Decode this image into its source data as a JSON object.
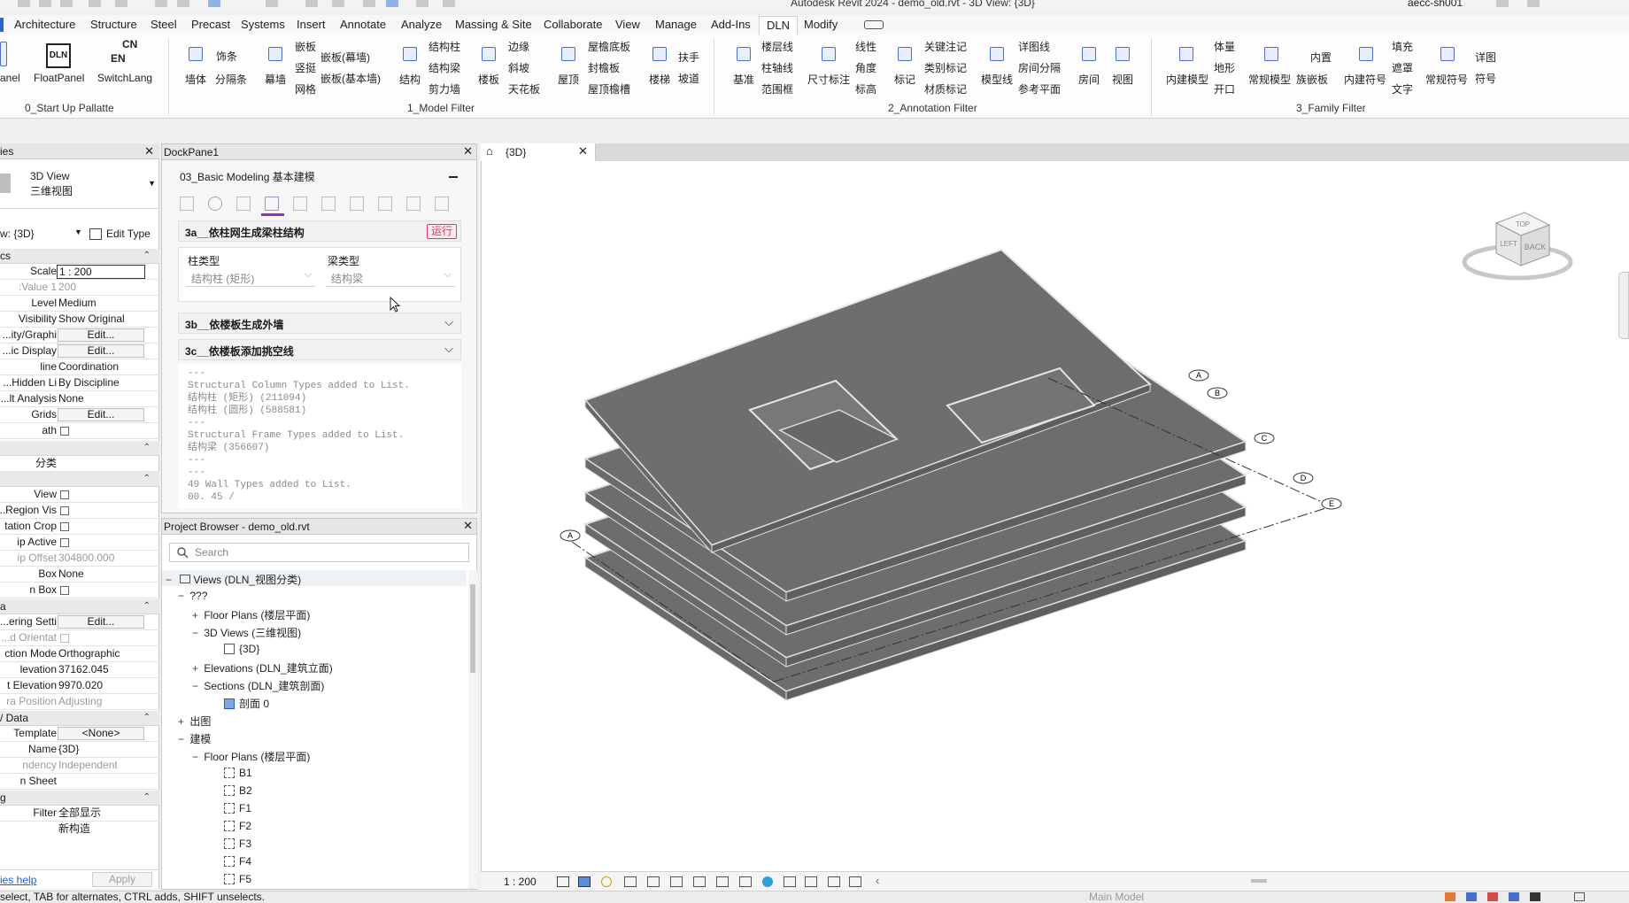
{
  "title_bar": {
    "title": "Autodesk Revit 2024 - demo_old.rvt - 3D View: {3D}",
    "user": "aecc-sh001"
  },
  "ribbon_tabs": [
    "Architecture",
    "Structure",
    "Steel",
    "Precast",
    "Systems",
    "Insert",
    "Annotate",
    "Analyze",
    "Massing & Site",
    "Collaborate",
    "View",
    "Manage",
    "Add-Ins",
    "DLN",
    "Modify"
  ],
  "active_tab": "DLN",
  "ribbon": {
    "startup": {
      "panel_label": "anel",
      "float_panel": "FloatPanel",
      "switch_lang": "SwitchLang",
      "switch_cn": "CN",
      "switch_en": "EN",
      "group": "0_Start Up Pallatte"
    },
    "model_filter": {
      "items": [
        "墙体",
        "饰条",
        "分隔条",
        "幕墙",
        "嵌板",
        "竖挺",
        "网格",
        "嵌板(幕墙)",
        "嵌板(基本墙)",
        "结构",
        "结构柱",
        "结构梁",
        "剪力墙",
        "楼板",
        "边缘",
        "斜坡",
        "天花板",
        "屋顶",
        "屋檐底板",
        "封檐板",
        "屋顶檐槽",
        "楼梯",
        "扶手",
        "坡道"
      ],
      "group": "1_Model Filter"
    },
    "annotation_filter": {
      "items": [
        "基准",
        "楼层线",
        "柱轴线",
        "范围框",
        "尺寸标注",
        "线性",
        "角度",
        "标高",
        "标记",
        "关键注记",
        "类别标记",
        "材质标记",
        "模型线",
        "详图线",
        "房间分隔",
        "参考平面",
        "房间",
        "视图"
      ],
      "group": "2_Annotation Filter"
    },
    "family_filter": {
      "items": [
        "内建模型",
        "体量",
        "地形",
        "开口",
        "常规模型",
        "内置",
        "族嵌板",
        "内建符号",
        "填充",
        "遮罩",
        "文字",
        "常规符号",
        "详图",
        "符号"
      ],
      "group": "3_Family Filter"
    }
  },
  "properties": {
    "header": "ies",
    "type_name_line1": "3D View",
    "type_name_line2": "三维视图",
    "view_selector": "w: {3D}",
    "edit_type": "Edit Type",
    "section_graphics": "cs",
    "rows": [
      {
        "key": "Scale",
        "value": "1 : 200"
      },
      {
        "key": "Value 1:",
        "value": "200"
      },
      {
        "key": "Level",
        "value": "Medium"
      },
      {
        "key": "Visibility",
        "value": "Show Original"
      },
      {
        "key": "ity/Graphi...",
        "value": "Edit..."
      },
      {
        "key": "ic Display...",
        "value": "Edit..."
      },
      {
        "key": "line",
        "value": "Coordination"
      },
      {
        "key": "Hidden Li...",
        "value": "By Discipline"
      },
      {
        "key": "lt Analysis...",
        "value": "None"
      },
      {
        "key": "Grids",
        "value": "Edit..."
      },
      {
        "key": "ath",
        "value": ""
      }
    ],
    "section_cat": "分类",
    "rows2": [
      {
        "key": "View",
        "value": ""
      },
      {
        "key": "Region Vis...",
        "value": ""
      },
      {
        "key": "tation Crop",
        "value": ""
      },
      {
        "key": "ip Active",
        "value": ""
      },
      {
        "key": "ip Offset",
        "value": "304800.000"
      },
      {
        "key": "Box",
        "value": "None"
      },
      {
        "key": "n Box",
        "value": ""
      }
    ],
    "section_a": "a",
    "rows3": [
      {
        "key": "ering Setti...",
        "value": "Edit..."
      },
      {
        "key": "d Orientat...",
        "value": ""
      },
      {
        "key": "ction Mode",
        "value": "Orthographic"
      },
      {
        "key": "levation",
        "value": "37162.045"
      },
      {
        "key": "t Elevation",
        "value": "9970.020"
      },
      {
        "key": "ra Position",
        "value": "Adjusting"
      }
    ],
    "section_data": "/ Data",
    "rows4": [
      {
        "key": "Template",
        "value": "<None>"
      },
      {
        "key": "Name",
        "value": "{3D}"
      },
      {
        "key": "ndency",
        "value": "Independent"
      },
      {
        "key": "n Sheet",
        "value": ""
      }
    ],
    "section_g": "g",
    "rows5": [
      {
        "key": "Filter",
        "value": "全部显示"
      },
      {
        "key": "",
        "value": "新构造"
      }
    ],
    "help_link": "ies help",
    "apply": "Apply"
  },
  "dock_pane": {
    "title": "DockPane1",
    "section_title": "03_Basic Modeling 基本建模",
    "card1_title": "3a__依柱网生成梁柱结构",
    "run_button": "运行",
    "col_type_label": "柱类型",
    "col_type_value": "结构柱 (矩形)",
    "beam_type_label": "梁类型",
    "beam_type_value": "结构梁",
    "card2_title": "3b__依楼板生成外墙",
    "card3_title": "3c__依楼板添加挑空线",
    "log": "---\nStructural Column Types added to List.\n结构柱 (矩形) (211094)\n结构柱 (圆形) (588581)\n---\nStructural Frame Types added to List.\n结构梁 (356607)\n---\n---\n49 Wall Types added to List.\n00. 45 /"
  },
  "project_browser": {
    "title": "Project Browser - demo_old.rvt",
    "search_placeholder": "Search",
    "nodes": [
      {
        "label": "Views (DLN_视图分类)"
      },
      {
        "label": "???"
      },
      {
        "label": "Floor Plans (楼层平面)"
      },
      {
        "label": "3D Views (三维视图)"
      },
      {
        "label": "{3D}"
      },
      {
        "label": "Elevations (DLN_建筑立面)"
      },
      {
        "label": "Sections (DLN_建筑剖面)"
      },
      {
        "label": "剖面 0"
      },
      {
        "label": "出图"
      },
      {
        "label": "建模"
      },
      {
        "label": "Floor Plans (楼层平面)"
      },
      {
        "label": "B1"
      },
      {
        "label": "B2"
      },
      {
        "label": "F1"
      },
      {
        "label": "F2"
      },
      {
        "label": "F3"
      },
      {
        "label": "F4"
      },
      {
        "label": "F5"
      }
    ]
  },
  "view": {
    "tab": "{3D}",
    "scale": "1 : 200",
    "viewcube_top": "TOP",
    "viewcube_back": "BACK",
    "viewcube_left": "LEFT",
    "grid_labels": [
      "A",
      "B",
      "C",
      "D",
      "E",
      "A"
    ]
  },
  "status_bar": {
    "hint": "select, TAB for alternates, CTRL adds, SHIFT unselects.",
    "model": "Main Model"
  },
  "colors": {
    "slab_top": "#6d6d6d",
    "slab_edge": "#e0e0e0",
    "accent": "#4a6fc9",
    "run_button": "#e0395a"
  }
}
